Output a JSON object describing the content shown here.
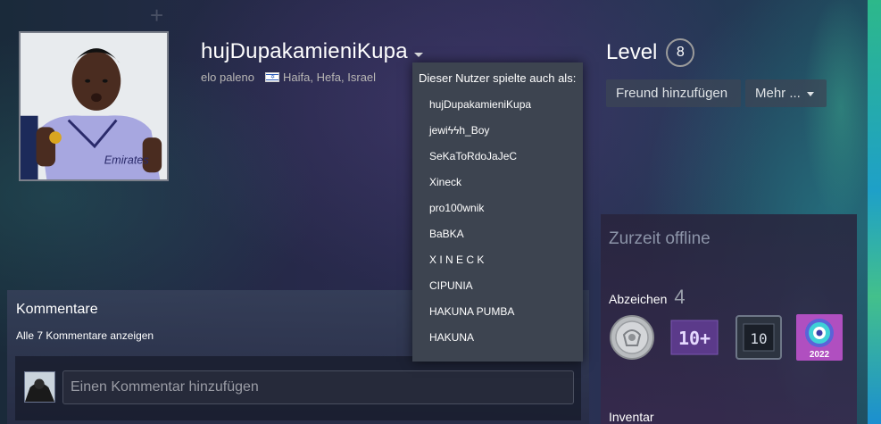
{
  "profile": {
    "persona_name": "hujDupakamieniKupa",
    "real_name": "elo paleno",
    "location": "Haifa, Hefa, Israel"
  },
  "alias_dropdown": {
    "header": "Dieser Nutzer spielte auch als:",
    "items": [
      "hujDupakamieniKupa",
      "jewiϟϟh_Boy",
      "SeKaToRdoJaJeC",
      "Xineck",
      "pro100wnik",
      "BaBKA",
      "X I N E C K",
      "CIPUNIA",
      "HAKUNA PUMBA",
      "HAKUNA"
    ]
  },
  "level": {
    "label": "Level",
    "value": "8"
  },
  "buttons": {
    "add_friend": "Freund hinzufügen",
    "more": "Mehr ..."
  },
  "status": {
    "text": "Zurzeit offline"
  },
  "badges": {
    "title": "Abzeichen",
    "count": "4",
    "items": [
      {
        "icon": "silver-coin-badge-icon"
      },
      {
        "icon": "ten-plus-years-badge-icon",
        "label": "10+"
      },
      {
        "icon": "ten-games-badge-icon",
        "label": "10"
      },
      {
        "icon": "steam-2022-badge-icon",
        "label": "2022"
      }
    ]
  },
  "inventory": {
    "title": "Inventar"
  },
  "comments": {
    "title": "Kommentare",
    "view_all": "Alle 7 Kommentare anzeigen",
    "input_placeholder": "Einen Kommentar hinzufügen"
  },
  "colors": {
    "dropdown_bg": "#3d4450",
    "accent_teal": "#1ea0c8"
  }
}
